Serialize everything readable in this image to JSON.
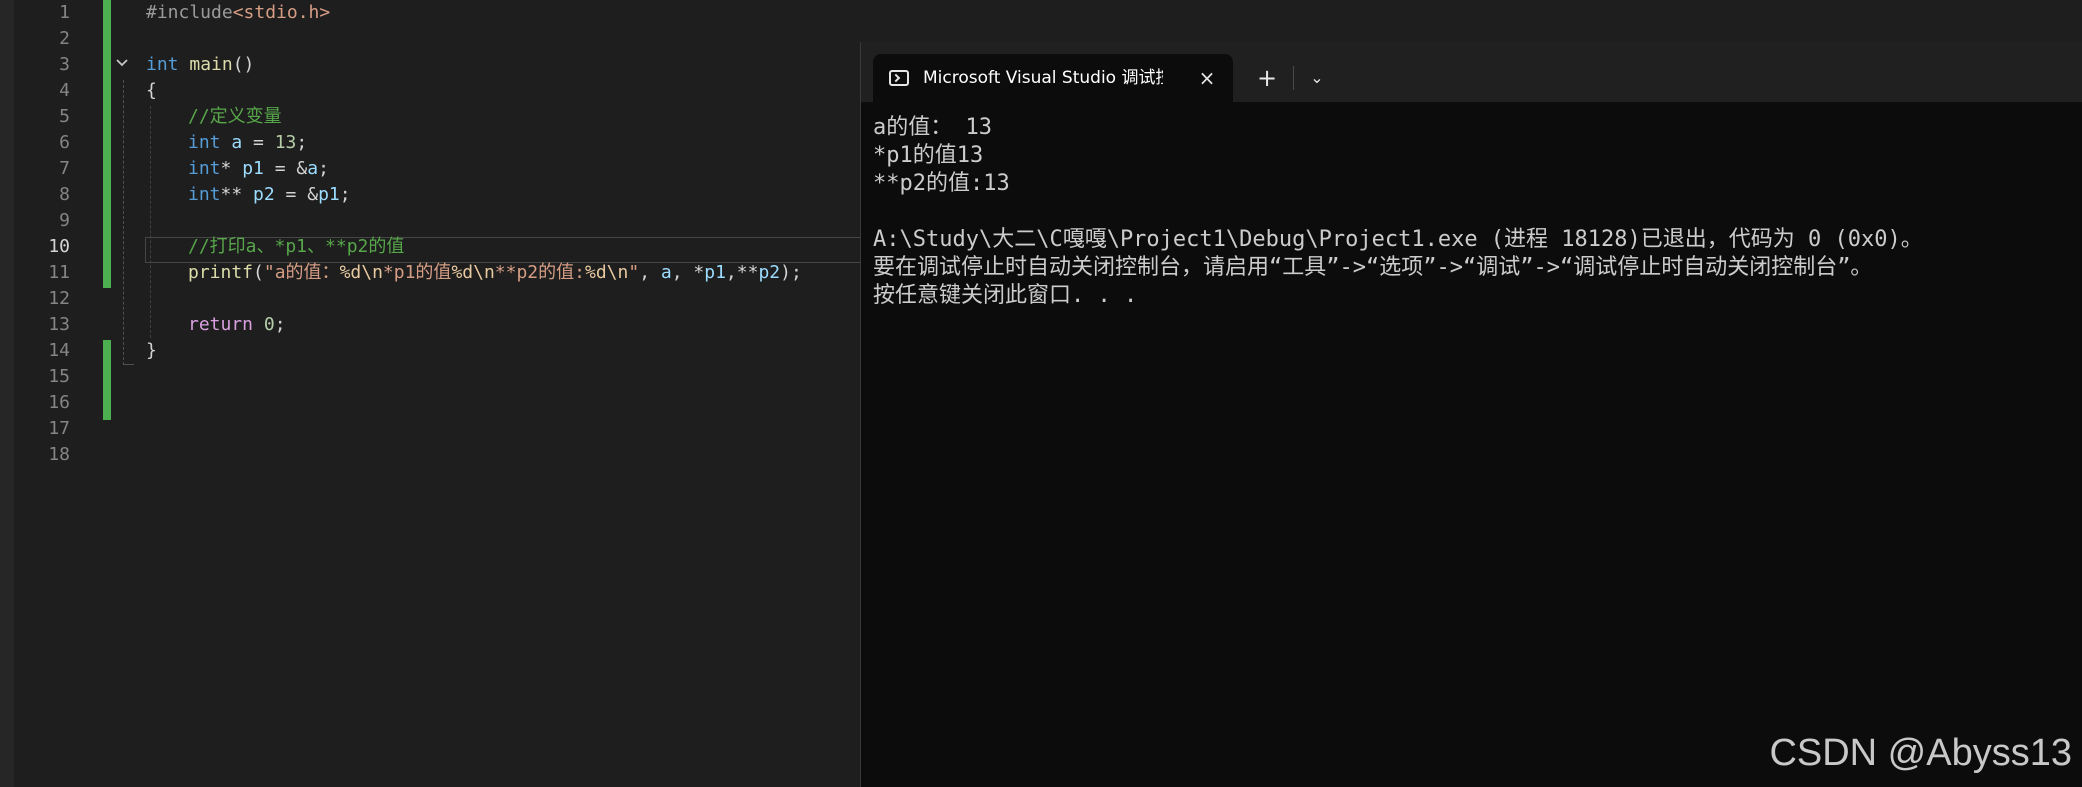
{
  "editor": {
    "line_numbers": [
      "1",
      "2",
      "3",
      "4",
      "5",
      "6",
      "7",
      "8",
      "9",
      "10",
      "11",
      "12",
      "13",
      "14",
      "15",
      "16",
      "17",
      "18"
    ],
    "current_line": "10",
    "code": {
      "l1": {
        "directive": "#include",
        "header": "<stdio.h>"
      },
      "l3": {
        "type": "int",
        "name": "main",
        "parens": "()"
      },
      "l4": "{",
      "l5": "//定义变量",
      "l6": {
        "type": "int",
        "var": "a",
        "eq": " = ",
        "num": "13",
        "end": ";"
      },
      "l7": {
        "type": "int",
        "ptr": "* ",
        "var": "p1",
        "eq": " = &",
        "ref": "a",
        "end": ";"
      },
      "l8": {
        "type": "int",
        "ptr": "** ",
        "var": "p2",
        "eq": " = &",
        "ref": "p1",
        "end": ";"
      },
      "l10": "//打印a、*p1、**p2的值",
      "l11": {
        "fn": "printf",
        "open": "(",
        "str1": "\"a的值：",
        "esc1": "%d\\n",
        "str2": "*p1的值",
        "esc2": "%d\\n",
        "str3": "**p2的值:",
        "esc3": "%d\\n",
        "str4": "\"",
        "sep1": ", ",
        "arg1": "a",
        "sep2": ", *",
        "arg2": "p1",
        "sep3": ",**",
        "arg3": "p2",
        "close": ");"
      },
      "l13": {
        "kw": "return",
        "sp": " ",
        "num": "0",
        "end": ";"
      },
      "l14": "}"
    }
  },
  "console": {
    "tab_title": "Microsoft Visual Studio 调试控制台",
    "close_icon": "×",
    "new_tab_icon": "+",
    "dropdown_icon": "⌄",
    "output": [
      "a的值： 13",
      "*p1的值13",
      "**p2的值:13",
      "",
      "A:\\Study\\大二\\C嘎嘎\\Project1\\Debug\\Project1.exe (进程 18128)已退出，代码为 0 (0x0)。",
      "要在调试停止时自动关闭控制台，请启用“工具”->“选项”->“调试”->“调试停止时自动关闭控制台”。",
      "按任意键关闭此窗口. . ."
    ]
  },
  "watermark": "CSDN @Abyss13"
}
